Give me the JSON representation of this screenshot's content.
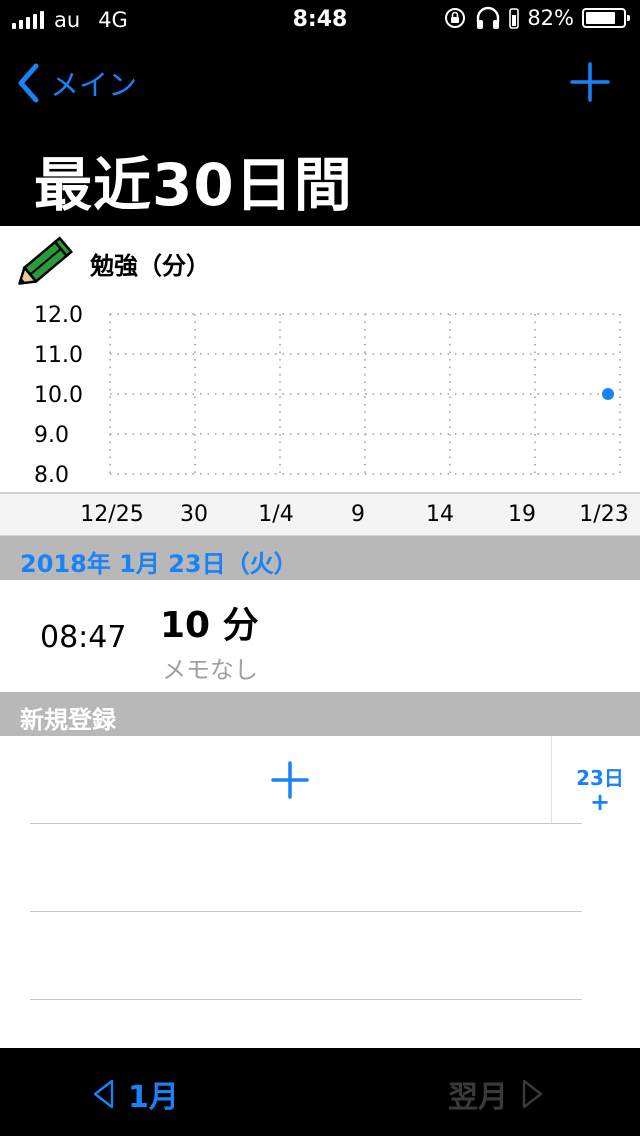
{
  "status_bar": {
    "carrier": "au",
    "network": "4G",
    "time": "8:48",
    "battery_percent": "82%",
    "battery_level": 0.82
  },
  "nav": {
    "back_label": "メイン",
    "title": "最近30日間"
  },
  "chart_header": {
    "label": "勉強（分）",
    "icon": "pencil-icon"
  },
  "chart_data": {
    "type": "scatter",
    "y_ticks": [
      "12.0",
      "11.0",
      "10.0",
      "9.0",
      "8.0"
    ],
    "x_ticks": [
      "12/25",
      "30",
      "1/4",
      "9",
      "14",
      "19",
      "1/23"
    ],
    "ylim": [
      8.0,
      12.0
    ],
    "x_range_days": [
      "12/25",
      "1/23"
    ],
    "grid": true,
    "series": [
      {
        "points": [
          {
            "x": "1/23",
            "y": 10
          }
        ],
        "color": "#1a82f7"
      }
    ]
  },
  "day_section": {
    "header": "2018年 1月 23日（火）",
    "entry": {
      "time": "08:47",
      "value": "10 分",
      "memo": "メモなし"
    }
  },
  "new_section": {
    "header": "新規登録",
    "side_button_date": "23日",
    "side_button_plus": "+"
  },
  "toolbar": {
    "prev_label": "1月",
    "next_label": "翌月"
  },
  "colors": {
    "accent": "#1a82f7",
    "section_bg": "#b8b8b8",
    "disabled": "#3a3a3a"
  }
}
